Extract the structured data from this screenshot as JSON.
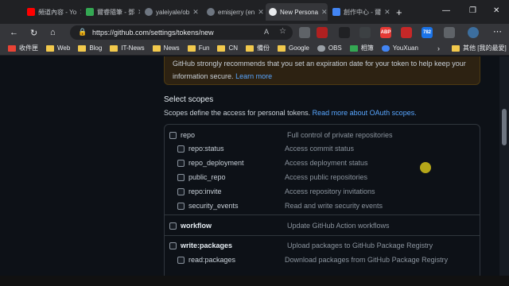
{
  "tabs": [
    {
      "label": "頻道內容 - Yo",
      "color": "#ff0000"
    },
    {
      "label": "爾睿隨筆 - 鄧",
      "color": "#34a853"
    },
    {
      "label": "yaleiyale/ob",
      "color": "#6e7681"
    },
    {
      "label": "emisjerry (en",
      "color": "#6e7681"
    },
    {
      "label": "New Persona",
      "color": "#6e7681"
    },
    {
      "label": "創作中心 - 爾",
      "color": "#4285f4"
    }
  ],
  "address": {
    "url": "https://github.com/settings/tokens/new"
  },
  "extensions": [
    "ABP",
    "782",
    "M+"
  ],
  "bookmarks": [
    "收件匣",
    "Web",
    "Blog",
    "IT-News",
    "News",
    "Fun",
    "CN",
    "備份",
    "Google",
    "OBS",
    "相簿",
    "YouXuan"
  ],
  "bookmarks_other": "其他 [我的最愛]",
  "warning": {
    "text": "GitHub strongly recommends that you set an expiration date for your token to help keep your information secure.",
    "link": "Learn more"
  },
  "section_title": "Select scopes",
  "section_desc": "Scopes define the access for personal tokens.",
  "section_link": "Read more about OAuth scopes.",
  "scopes": {
    "repo": {
      "name": "repo",
      "desc": "Full control of private repositories"
    },
    "repo_status": {
      "name": "repo:status",
      "desc": "Access commit status"
    },
    "repo_deployment": {
      "name": "repo_deployment",
      "desc": "Access deployment status"
    },
    "public_repo": {
      "name": "public_repo",
      "desc": "Access public repositories"
    },
    "repo_invite": {
      "name": "repo:invite",
      "desc": "Access repository invitations"
    },
    "security_events": {
      "name": "security_events",
      "desc": "Read and write security events"
    },
    "workflow": {
      "name": "workflow",
      "desc": "Update GitHub Action workflows"
    },
    "write_packages": {
      "name": "write:packages",
      "desc": "Upload packages to GitHub Package Registry"
    },
    "read_packages": {
      "name": "read:packages",
      "desc": "Download packages from GitHub Package Registry"
    }
  }
}
